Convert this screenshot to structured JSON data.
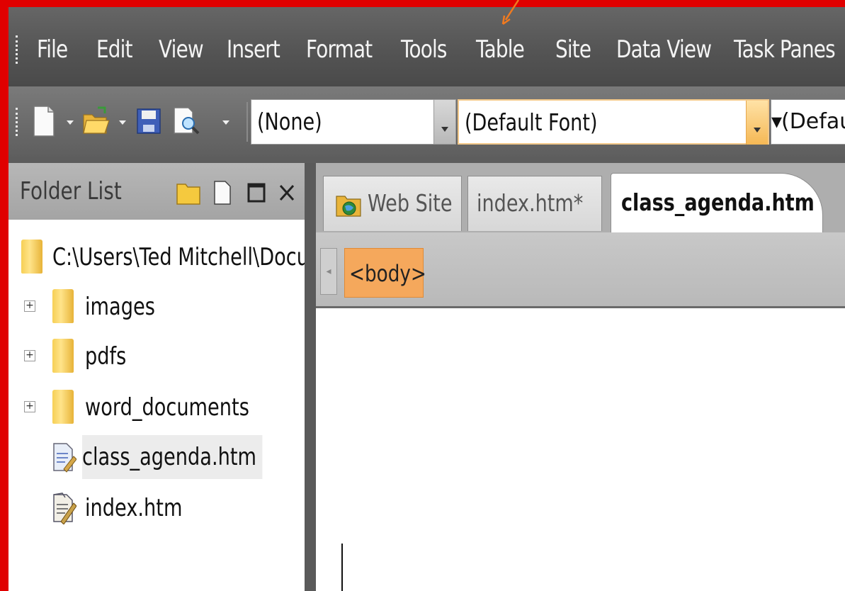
{
  "menu": {
    "items": [
      {
        "label": "File",
        "key": "F"
      },
      {
        "label": "Edit",
        "key": "E"
      },
      {
        "label": "View",
        "key": "V"
      },
      {
        "label": "Insert",
        "key": "I"
      },
      {
        "label": "Format",
        "key": "o"
      },
      {
        "label": "Tools",
        "key": "T"
      },
      {
        "label": "Table",
        "key": "a"
      },
      {
        "label": "Site",
        "key": "S"
      },
      {
        "label": "Data View",
        "key": "D"
      },
      {
        "label": "Task Panes",
        "key": "k"
      }
    ]
  },
  "toolbar": {
    "style_value": "(None)",
    "font_value": "(Default Font)",
    "size_value": "(Default"
  },
  "folder_list": {
    "title": "Folder List",
    "root": "C:\\Users\\Ted Mitchell\\Documer",
    "items": [
      {
        "label": "images",
        "type": "folder",
        "expandable": true
      },
      {
        "label": "pdfs",
        "type": "folder",
        "expandable": true
      },
      {
        "label": "word_documents",
        "type": "folder",
        "expandable": true
      },
      {
        "label": "class_agenda.htm",
        "type": "page",
        "selected": true
      },
      {
        "label": "index.htm",
        "type": "page"
      }
    ]
  },
  "tabs": [
    {
      "label": "Web Site"
    },
    {
      "label": "index.htm*"
    },
    {
      "label": "class_agenda.htm",
      "active": true
    }
  ],
  "tag_selector": {
    "tag": "<body>"
  },
  "colors": {
    "frame": "#e00000",
    "arrow": "#f07a20",
    "tag_highlight": "#f5a85c"
  }
}
